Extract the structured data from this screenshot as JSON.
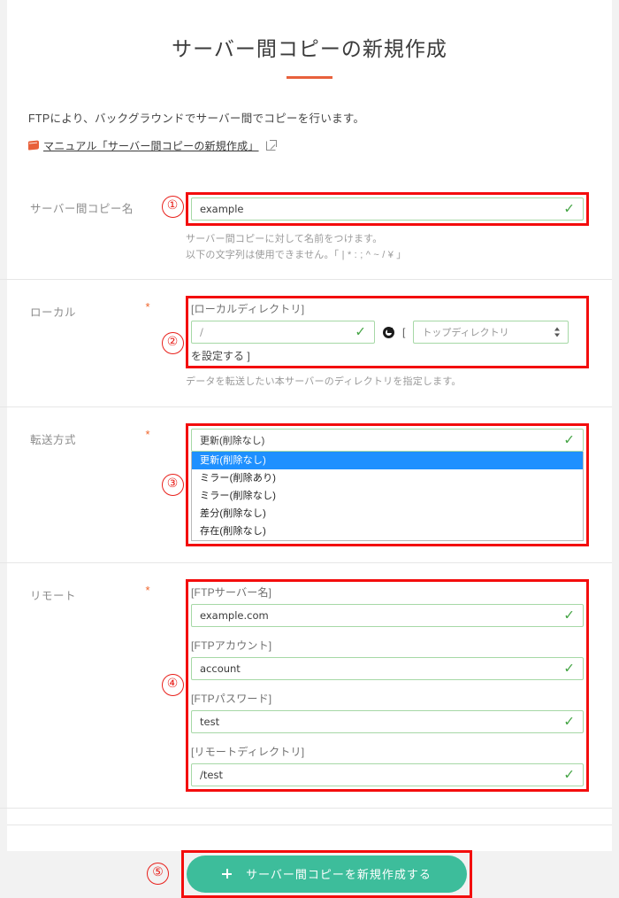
{
  "header": {
    "title": "サーバー間コピーの新規作成",
    "lead": "FTPにより、バックグラウンドでサーバー間でコピーを行います。",
    "manual_link": "マニュアル「サーバー間コピーの新規作成」",
    "book_icon": "book-icon",
    "external_icon": "external-link-icon"
  },
  "colors": {
    "accent_rule": "#e8613c",
    "required_asterisk": "#f0642a",
    "marker_red": "#e8201b",
    "highlight_red": "#f30d0d",
    "valid_green": "#46a546",
    "input_border_green": "#a6d8a6",
    "dropdown_selected_blue": "#1e90ff",
    "submit_button": "#3dbd9b"
  },
  "rows": {
    "copy_name": {
      "marker": "①",
      "label": "サーバー間コピー名",
      "required": "",
      "value": "example",
      "valid_mark": "✓",
      "helper_1": "サーバー間コピーに対して名前をつけます。",
      "helper_2": "以下の文字列は使用できません。「 | * : ; ^ ~ / ¥ 」"
    },
    "local": {
      "marker": "②",
      "label": "ローカル",
      "required": "*",
      "field_label": "[ローカルディレクトリ]",
      "value": "/",
      "valid_mark": "✓",
      "refresh_icon": "refresh-icon",
      "open_bracket": "[",
      "select_value": "トップディレクトリ",
      "set_text": "を設定する ]",
      "helper": "データを転送したい本サーバーのディレクトリを指定します。"
    },
    "transfer": {
      "marker": "③",
      "label": "転送方式",
      "required": "*",
      "selected": "更新(削除なし)",
      "valid_mark": "✓",
      "options": [
        "更新(削除なし)",
        "ミラー(削除あり)",
        "ミラー(削除なし)",
        "差分(削除なし)",
        "存在(削除なし)"
      ],
      "selected_index": 0
    },
    "remote": {
      "marker": "④",
      "label": "リモート",
      "required": "*",
      "fields": [
        {
          "label": "[FTPサーバー名]",
          "value": "example.com",
          "valid_mark": "✓"
        },
        {
          "label": "[FTPアカウント]",
          "value": "account",
          "valid_mark": "✓"
        },
        {
          "label": "[FTPパスワード]",
          "value": "test",
          "valid_mark": "✓"
        },
        {
          "label": "[リモートディレクトリ]",
          "value": "/test",
          "valid_mark": "✓"
        }
      ]
    }
  },
  "submit": {
    "marker": "⑤",
    "label": "サーバー間コピーを新規作成する",
    "plus_icon": "plus-icon"
  }
}
